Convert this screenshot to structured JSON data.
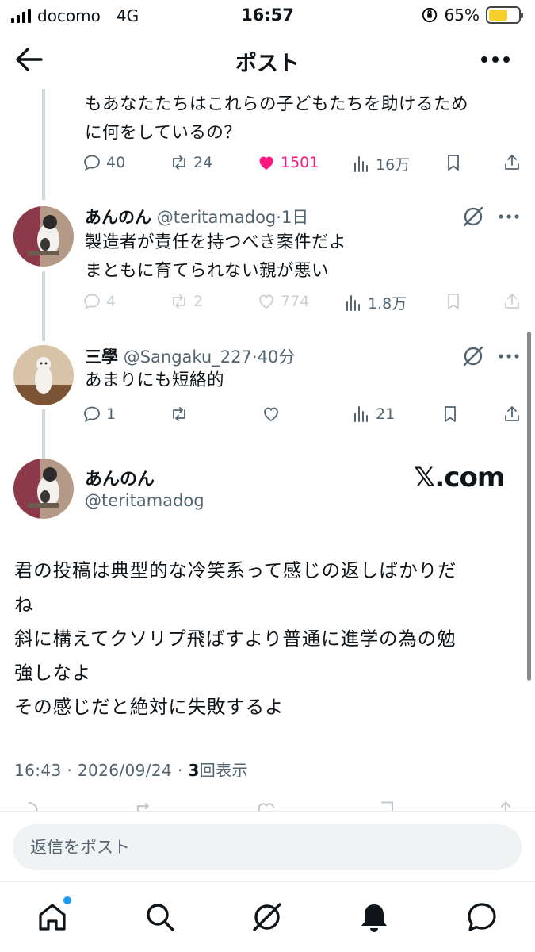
{
  "status_bar": {
    "carrier": "docomo",
    "network": "4G",
    "time": "16:57",
    "battery": "65%",
    "battery_level": 0.65
  },
  "header": {
    "title": "ポスト"
  },
  "posts": [
    {
      "text_lines": [
        "もあなたたちはこれらの子どもたちを助けるため",
        "に何をしているの？"
      ],
      "actions": {
        "reply": "40",
        "repost": "24",
        "like": "1501",
        "views": "16万"
      },
      "liked": true
    },
    {
      "display_name": "あんのん",
      "handle": "@teritamadog",
      "time": "1日",
      "text_lines": [
        "製造者が責任を持つべき案件だよ",
        "まともに育てられない親が悪い"
      ],
      "actions": {
        "reply": "4",
        "repost": "2",
        "like": "774",
        "views": "1.8万"
      }
    },
    {
      "display_name": "三學",
      "handle": "@Sangaku_227",
      "time": "40分",
      "text_lines": [
        "あまりにも短絡的"
      ],
      "actions": {
        "reply": "1",
        "repost": "",
        "like": "",
        "views": "21"
      }
    }
  ],
  "main_post": {
    "display_name": "あんのん",
    "handle": "@teritamadog",
    "watermark": "𝕏.com",
    "text_lines": [
      "君の投稿は典型的な冷笑系って感じの返しばかりだ",
      "ね",
      "斜に構えてクソリプ飛ばすより普通に進学の為の勉",
      "強しなよ",
      "その感じだと絶対に失敗するよ"
    ],
    "timestamp": "16:43 · 2026/09/24 · ",
    "views_count": "3",
    "views_label": "回表示"
  },
  "reply_bar": {
    "placeholder": "返信をポスト"
  },
  "tabbar": {
    "items": [
      "home-icon",
      "search-icon",
      "grok-icon",
      "bell-icon",
      "messages-icon"
    ]
  },
  "colors": {
    "like_pink": "#f91880",
    "muted": "#536471",
    "accent": "#1d9bf0"
  }
}
